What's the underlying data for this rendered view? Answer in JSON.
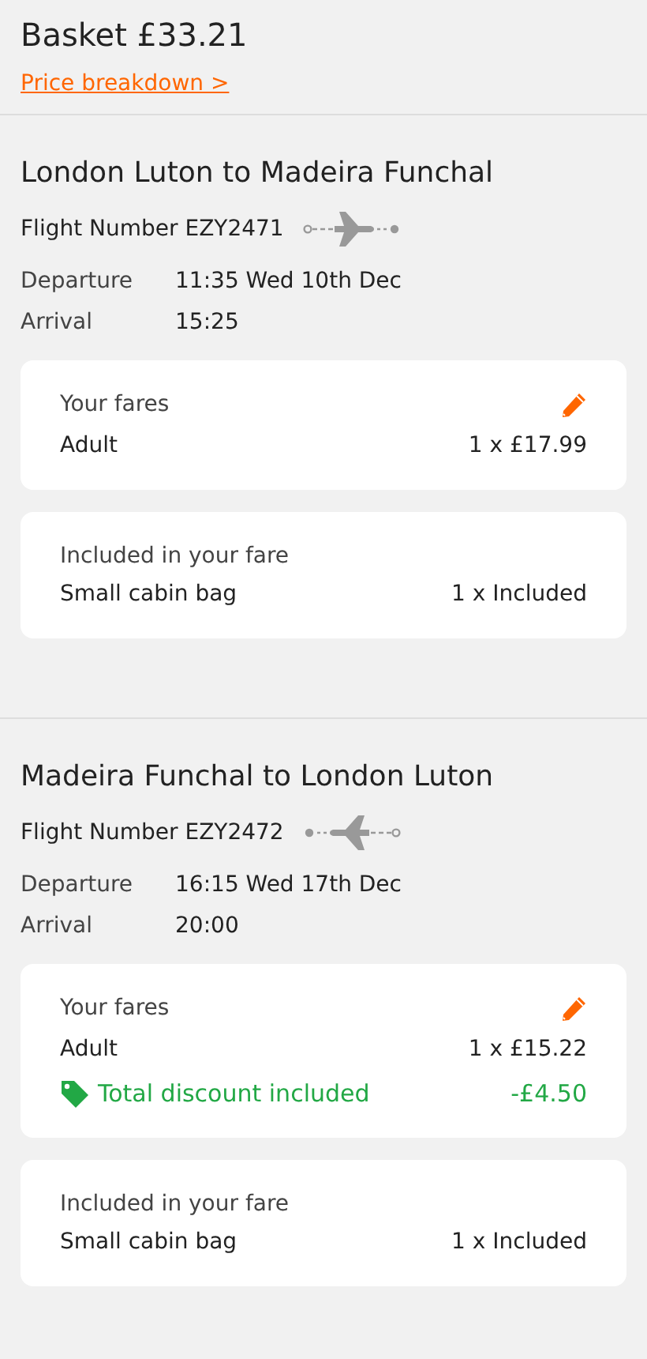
{
  "basket": {
    "title": "Basket £33.21",
    "link": "Price breakdown >"
  },
  "flights": [
    {
      "route": "London Luton to Madeira Funchal",
      "flight_number": "Flight Number EZY2471",
      "kind": "outbound",
      "departure_label": "Departure",
      "departure": "11:35 Wed 10th Dec",
      "arrival_label": "Arrival",
      "arrival": "15:25",
      "fares": {
        "title": "Your fares",
        "passenger": "Adult",
        "price": "1 x £17.99"
      },
      "included": {
        "title": "Included in your fare",
        "item": "Small cabin bag",
        "quantity": "1 x Included"
      }
    },
    {
      "route": "Madeira Funchal to London Luton",
      "flight_number": "Flight Number EZY2472",
      "kind": "inbound",
      "departure_label": "Departure",
      "departure": "16:15 Wed 17th Dec",
      "arrival_label": "Arrival",
      "arrival": "20:00",
      "fares": {
        "title": "Your fares",
        "passenger": "Adult",
        "price": "1 x £15.22",
        "discount": {
          "label": "Total discount included",
          "amount": "-£4.50"
        }
      },
      "included": {
        "title": "Included in your fare",
        "item": "Small cabin bag",
        "quantity": "1 x Included"
      }
    }
  ]
}
